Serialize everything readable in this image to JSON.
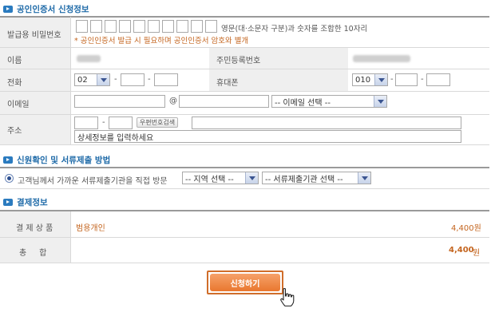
{
  "cert_section": {
    "title": "공인인증서 신청정보",
    "password_label": "발급용 비밀번호",
    "password_boxes": 10,
    "password_hint": "영문(대·소문자 구분)과 숫자를 조합한 10자리",
    "password_note": "* 공인인증서 발급 시 필요하며 공인인증서 암호와 별개",
    "name_label": "이름",
    "resident_label": "주민등록번호",
    "phone_label": "전화",
    "phone_area_code": "02",
    "mobile_label": "휴대폰",
    "mobile_prefix": "010",
    "email_label": "이메일",
    "email_at": "@",
    "email_domain_select": "-- 이메일 선택 --",
    "address_label": "주소",
    "zipcode_button": "우편번호검색",
    "address_detail_placeholder": "상세정보를 입력하세요"
  },
  "submission_section": {
    "title": "신원확인 및 서류제출 방법",
    "visit_option": "고객님께서 가까운 서류제출기관을 직접 방문",
    "region_select": "-- 지역 선택 --",
    "institution_select": "-- 서류제출기관 선택 --"
  },
  "payment_section": {
    "title": "결제정보",
    "product_label": "결 제 상 품",
    "product_name": "범용개인",
    "product_price": "4,400원",
    "total_label": "총     합",
    "total_amount": "4,400",
    "total_unit": "원"
  },
  "submit_button": "신청하기",
  "colors": {
    "section_title": "#1e6aa8",
    "accent_orange": "#c4651f",
    "submit_button": "#e9772f"
  }
}
